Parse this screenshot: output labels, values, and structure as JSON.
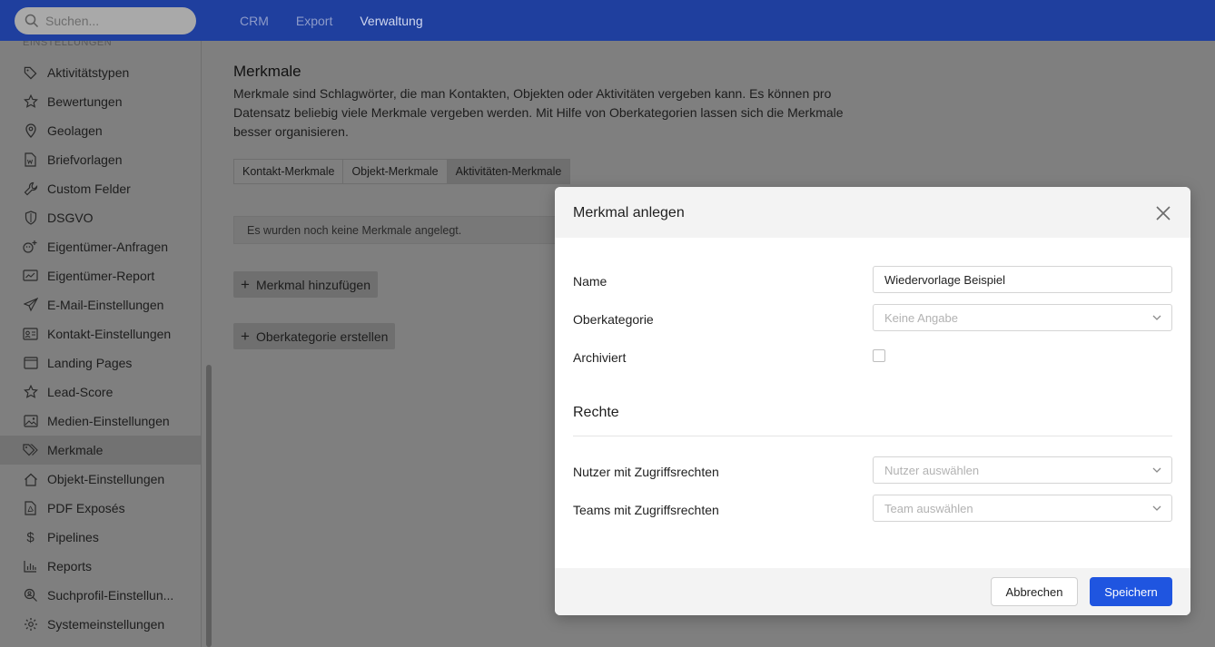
{
  "search": {
    "placeholder": "Suchen..."
  },
  "nav": [
    "CRM",
    "Export",
    "Verwaltung"
  ],
  "sidebar": {
    "section": "EINSTELLUNGEN",
    "items": [
      {
        "label": "Aktivitätstypen",
        "icon": "tag-icon"
      },
      {
        "label": "Bewertungen",
        "icon": "star-icon"
      },
      {
        "label": "Geolagen",
        "icon": "map-pin-icon"
      },
      {
        "label": "Briefvorlagen",
        "icon": "word-document-icon"
      },
      {
        "label": "Custom Felder",
        "icon": "wrench-icon"
      },
      {
        "label": "DSGVO",
        "icon": "shield-icon"
      },
      {
        "label": "Eigentümer-Anfragen",
        "icon": "user-plus-icon"
      },
      {
        "label": "Eigentümer-Report",
        "icon": "report-chart-icon"
      },
      {
        "label": "E-Mail-Einstellungen",
        "icon": "paper-plane-icon"
      },
      {
        "label": "Kontakt-Einstellungen",
        "icon": "contact-card-icon"
      },
      {
        "label": "Landing Pages",
        "icon": "browser-window-icon"
      },
      {
        "label": "Lead-Score",
        "icon": "star-icon"
      },
      {
        "label": "Medien-Einstellungen",
        "icon": "image-icon"
      },
      {
        "label": "Merkmale",
        "icon": "tags-icon"
      },
      {
        "label": "Objekt-Einstellungen",
        "icon": "home-icon"
      },
      {
        "label": "PDF Exposés",
        "icon": "pdf-icon"
      },
      {
        "label": "Pipelines",
        "icon": "dollar-icon"
      },
      {
        "label": "Reports",
        "icon": "bar-chart-icon"
      },
      {
        "label": "Suchprofil-Einstellun...",
        "icon": "search-profile-icon"
      },
      {
        "label": "Systemeinstellungen",
        "icon": "gear-icon"
      }
    ],
    "active_index": 13
  },
  "main": {
    "title": "Merkmale",
    "description": "Merkmale sind Schlagwörter, die man Kontakten, Objekten oder Aktivitäten vergeben kann. Es können pro Datensatz beliebig viele Merkmale vergeben werden. Mit Hilfe von Oberkategorien lassen sich die Merkmale besser organisieren.",
    "tabs": [
      "Kontakt-Merkmale",
      "Objekt-Merkmale",
      "Aktivitäten-Merkmale"
    ],
    "active_tab": 2,
    "empty_note": "Es wurden noch keine Merkmale angelegt.",
    "add_label": "Merkmal hinzufügen",
    "category_label": "Oberkategorie erstellen"
  },
  "modal": {
    "title": "Merkmal anlegen",
    "fields": {
      "name_label": "Name",
      "name_value": "Wiedervorlage Beispiel",
      "parent_label": "Oberkategorie",
      "parent_placeholder": "Keine Angabe",
      "archived_label": "Archiviert",
      "archived_checked": false
    },
    "rights": {
      "title": "Rechte",
      "users_label": "Nutzer mit Zugriffsrechten",
      "users_placeholder": "Nutzer auswählen",
      "teams_label": "Teams mit Zugriffsrechten",
      "teams_placeholder": "Team auswählen"
    },
    "cancel": "Abbrechen",
    "save": "Speichern"
  },
  "colors": {
    "topbar": "#1f3f9e",
    "primary": "#1f55e0",
    "overlay": "#7f7f7f"
  }
}
